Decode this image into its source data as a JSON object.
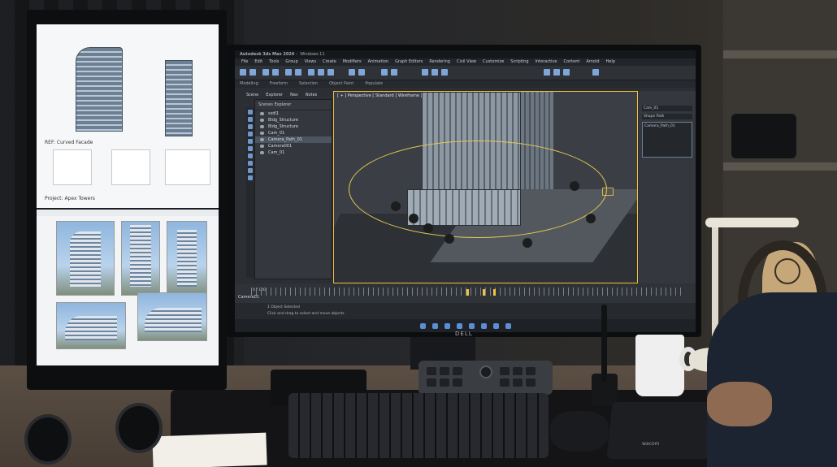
{
  "left_monitor": {
    "facade_label": "REF: Curved Facade",
    "project_label": "Project: Apex Towers"
  },
  "app": {
    "title": "Autodesk 3ds Max 2024",
    "os": "Windows 11",
    "menu": [
      "File",
      "Edit",
      "Tools",
      "Group",
      "Views",
      "Create",
      "Modifiers",
      "Animation",
      "Graph Editors",
      "Rendering",
      "Civil View",
      "Customize",
      "Scripting",
      "Interactive",
      "Content",
      "Arnold",
      "Help"
    ],
    "ribbon": [
      "Modeling",
      "Freeform",
      "Selection",
      "Object Paint",
      "Populate"
    ],
    "explorer_tabs": [
      "Scene",
      "Explorer",
      "Nav",
      "Notes"
    ],
    "explorer_header": "Scenes Explorer",
    "scene_items": [
      {
        "name": "ssdl1",
        "selected": false
      },
      {
        "name": "Bldg_Structure",
        "selected": false
      },
      {
        "name": "Bldg_Structure",
        "selected": false
      },
      {
        "name": "Cam_01",
        "selected": false
      },
      {
        "name": "Camera_Path_01",
        "selected": true
      },
      {
        "name": "Camera001",
        "selected": false
      },
      {
        "name": "Cam_01",
        "selected": false
      }
    ],
    "viewport_label": "[ + ] Perspective [ Standard ] Wireframe ]",
    "right_panel": {
      "object_name": "Cam_01",
      "list_header": "Shape Path",
      "list_item": "Camera_Path_01"
    },
    "camera_select": "Camera01",
    "frame_readout": "0 / 100",
    "status_line1": "1 Object Selected",
    "status_line2": "Click and drag to select and move objects",
    "accent_color": "#f0c040"
  },
  "monitor_brand": "DELL",
  "tablet_brand": "wacom"
}
